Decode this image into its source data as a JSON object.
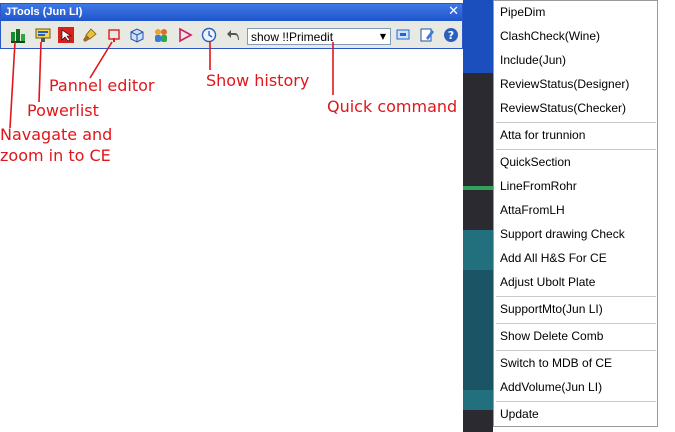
{
  "window": {
    "title": "JTools (Jun LI)",
    "close_glyph": "✕"
  },
  "toolbar": {
    "quick_command_value": "show !!Primedit",
    "icons": [
      "navigate-icon",
      "powerlist-icon",
      "select-icon",
      "brush-icon",
      "panel-editor-icon",
      "cube-icon",
      "users-icon",
      "play-icon",
      "history-clock-icon",
      "undo-icon",
      "dropdown-arrow",
      "monitor-icon",
      "edit-icon",
      "help-icon"
    ]
  },
  "annotations": {
    "panel_editor": "Pannel editor",
    "powerlist": "Powerlist",
    "navigate_line1": "Navagate and",
    "navigate_line2": "zoom in to CE",
    "show_history": "Show history",
    "quick_command": "Quick command",
    "color": "#e0161b"
  },
  "menu": {
    "group1": [
      "PipeDim",
      "ClashCheck(Wine)",
      "Include(Jun)",
      "ReviewStatus(Designer)",
      "ReviewStatus(Checker)"
    ],
    "group2": [
      "Atta for trunnion"
    ],
    "group3": [
      "QuickSection",
      "LineFromRohr",
      "AttaFromLH",
      "Support drawing Check",
      "Add All H&S For CE",
      "Adjust Ubolt Plate"
    ],
    "group4": [
      "SupportMto(Jun LI)"
    ],
    "group5": [
      "Show Delete Comb"
    ],
    "group6": [
      "Switch to MDB of CE",
      "AddVolume(Jun LI)"
    ],
    "group7": [
      "Update"
    ]
  }
}
